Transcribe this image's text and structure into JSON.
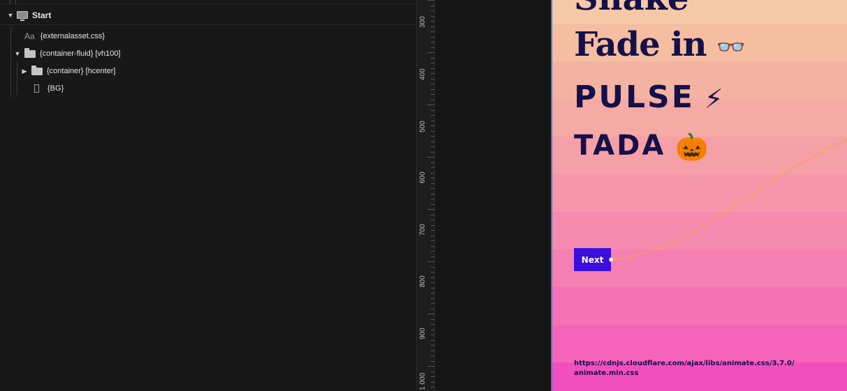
{
  "layers": {
    "root": {
      "label": "Start",
      "icon": "monitor-icon"
    },
    "items": [
      {
        "label": "{externalasset.css}",
        "icon_text": "Aa"
      },
      {
        "label": "{container-fluid} [vh100]"
      },
      {
        "label": "{container} [hcenter]"
      },
      {
        "label": "{BG}"
      }
    ]
  },
  "ruler": {
    "labels": [
      "300",
      "400",
      "500",
      "600",
      "700",
      "800",
      "900",
      "1 000"
    ]
  },
  "canvas": {
    "headline_top": "Shake",
    "fade_label": "Fade in",
    "fade_emoji": "👓",
    "pulse_label": "PULSE",
    "pulse_emoji": "⚡",
    "tada_label": "TADA",
    "tada_emoji": "🎃",
    "next_button": "Next",
    "url_line1": "https://cdnjs.cloudflare.com/ajax/libs/animate.css/3.7.0/",
    "url_line2": "animate.min.css"
  },
  "colors": {
    "accent": "#3b0fdc",
    "connector": "#f6a24a",
    "text_dark": "#14104a",
    "selection_border": "#3f7be0"
  }
}
